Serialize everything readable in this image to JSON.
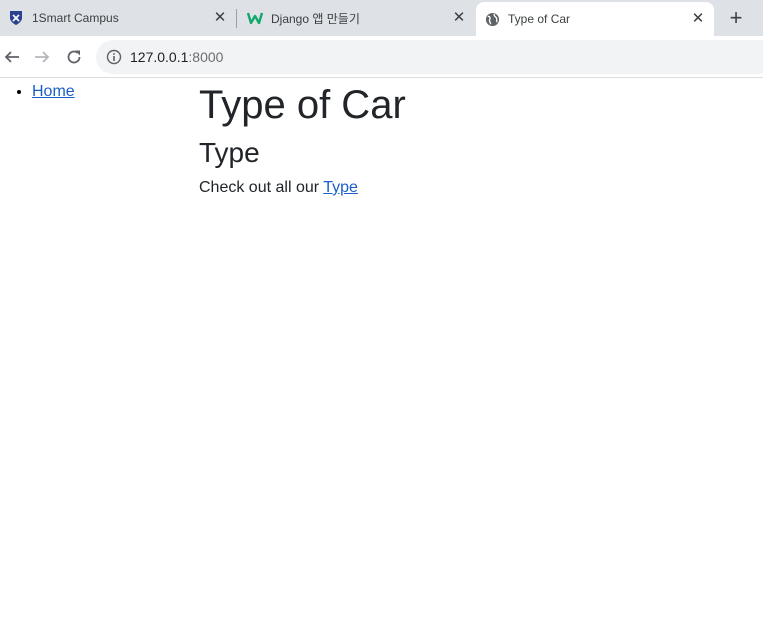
{
  "browser": {
    "tabs": [
      {
        "title": "1Smart Campus",
        "icon": "shield-icon"
      },
      {
        "title": "Django 앱 만들기",
        "icon": "w-logo-icon"
      },
      {
        "title": "Type of Car",
        "icon": "globe-icon"
      }
    ],
    "close_glyph": "✕",
    "new_tab_glyph": "+",
    "address": {
      "host": "127.0.0.1",
      "port": ":8000"
    }
  },
  "page": {
    "nav": [
      {
        "label": "Home"
      }
    ],
    "heading": "Type of Car",
    "subheading": "Type",
    "paragraph_text": "Check out all our ",
    "paragraph_link": "Type"
  },
  "colors": {
    "tabstrip_bg": "#dee1e6",
    "link": "#1a5fc6",
    "text": "#212529"
  }
}
